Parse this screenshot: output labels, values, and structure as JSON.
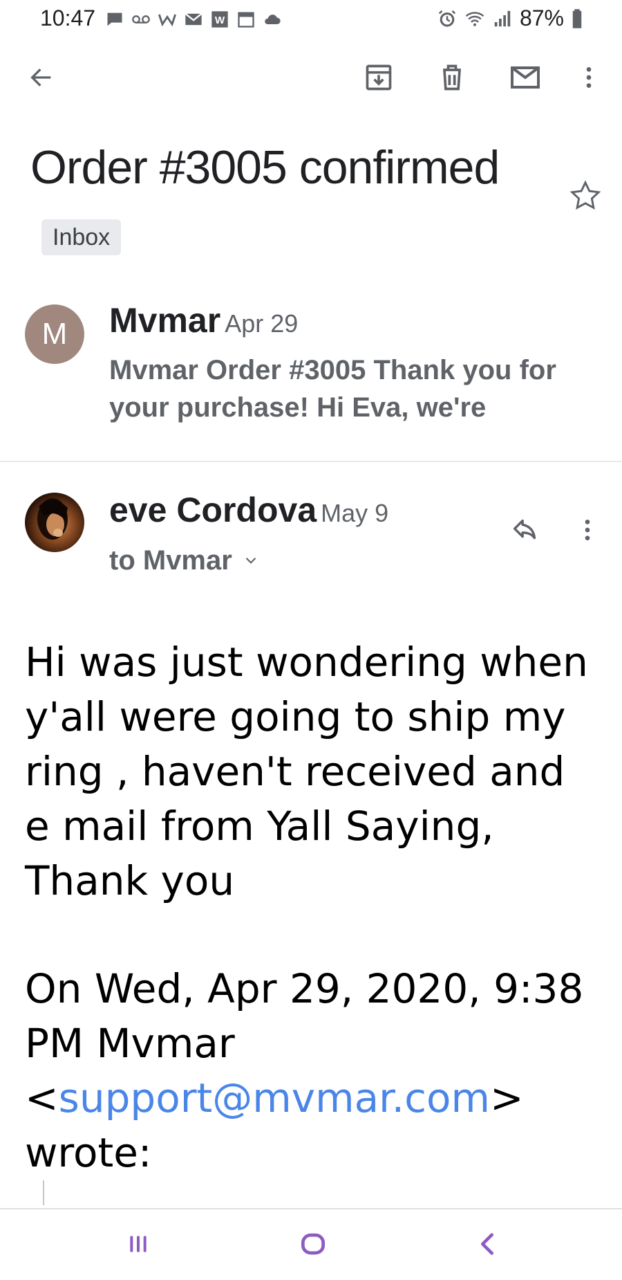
{
  "status_bar": {
    "time": "10:47",
    "battery_percent": "87%",
    "left_icons": [
      "chat-icon",
      "voicemail-icon",
      "app-w-icon",
      "mail-icon",
      "word-icon",
      "calendar-icon",
      "cloud-icon"
    ],
    "right_icons": [
      "alarm-icon",
      "wifi-icon",
      "signal-icon",
      "battery-icon"
    ]
  },
  "toolbar": {
    "icons": [
      "back-arrow-icon",
      "archive-icon",
      "delete-icon",
      "mark-unread-icon",
      "more-vert-icon"
    ]
  },
  "thread": {
    "subject": "Order #3005 confirmed",
    "label": "Inbox"
  },
  "message1": {
    "avatar_letter": "M",
    "avatar_color": "#a1887f",
    "sender": "Mvmar",
    "date": "Apr 29",
    "snippet": "Mvmar Order #3005 Thank you for your purchase! Hi Eva, we're"
  },
  "message2": {
    "sender": "eve Cordova",
    "date": "May 9",
    "to": "to Mvmar",
    "body": "Hi was just wondering when y'all were going to ship my ring , haven't received and e mail from Yall Saying, Thank you",
    "quote_prefix": "On Wed, Apr 29, 2020, 9:38 PM Mvmar <",
    "quote_email": "support@mvmar.com",
    "quote_suffix": "> wrote:"
  },
  "colors": {
    "link": "#4a86e8",
    "nav_accent": "#8e5bc2",
    "badge_bg": "#e8eaed"
  },
  "nav_bar": {
    "icons": [
      "recent-apps-icon",
      "home-icon",
      "back-icon"
    ]
  }
}
